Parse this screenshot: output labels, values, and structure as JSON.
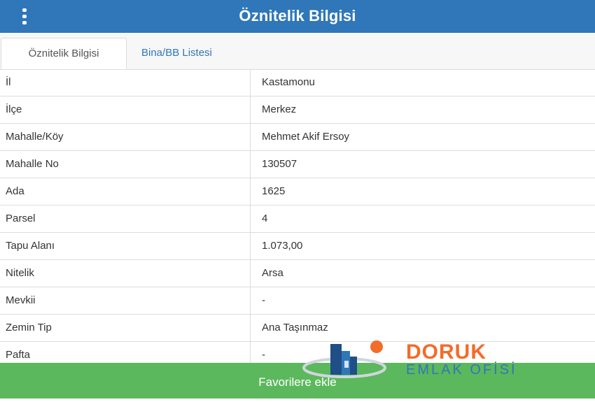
{
  "header": {
    "title": "Öznitelik Bilgisi",
    "menu_icon": "vertical-dots-icon"
  },
  "tabs": [
    {
      "label": "Öznitelik Bilgisi",
      "active": true
    },
    {
      "label": "Bina/BB Listesi",
      "active": false
    }
  ],
  "rows": [
    {
      "key": "İl",
      "value": "Kastamonu"
    },
    {
      "key": "İlçe",
      "value": "Merkez"
    },
    {
      "key": "Mahalle/Köy",
      "value": "Mehmet Akif Ersoy"
    },
    {
      "key": "Mahalle No",
      "value": "130507"
    },
    {
      "key": "Ada",
      "value": "1625"
    },
    {
      "key": "Parsel",
      "value": "4"
    },
    {
      "key": "Tapu Alanı",
      "value": "1.073,00"
    },
    {
      "key": "Nitelik",
      "value": "Arsa"
    },
    {
      "key": "Mevkii",
      "value": "-"
    },
    {
      "key": "Zemin Tip",
      "value": "Ana Taşınmaz"
    },
    {
      "key": "Pafta",
      "value": "-"
    }
  ],
  "footer": {
    "button_label": "Favorilere ekle"
  },
  "watermark": {
    "name": "DORUK",
    "subtitle": "EMLAK OFİSİ"
  },
  "colors": {
    "header": "#2f77b8",
    "footer": "#5cb85c",
    "watermark_orange": "#f26c2a"
  }
}
